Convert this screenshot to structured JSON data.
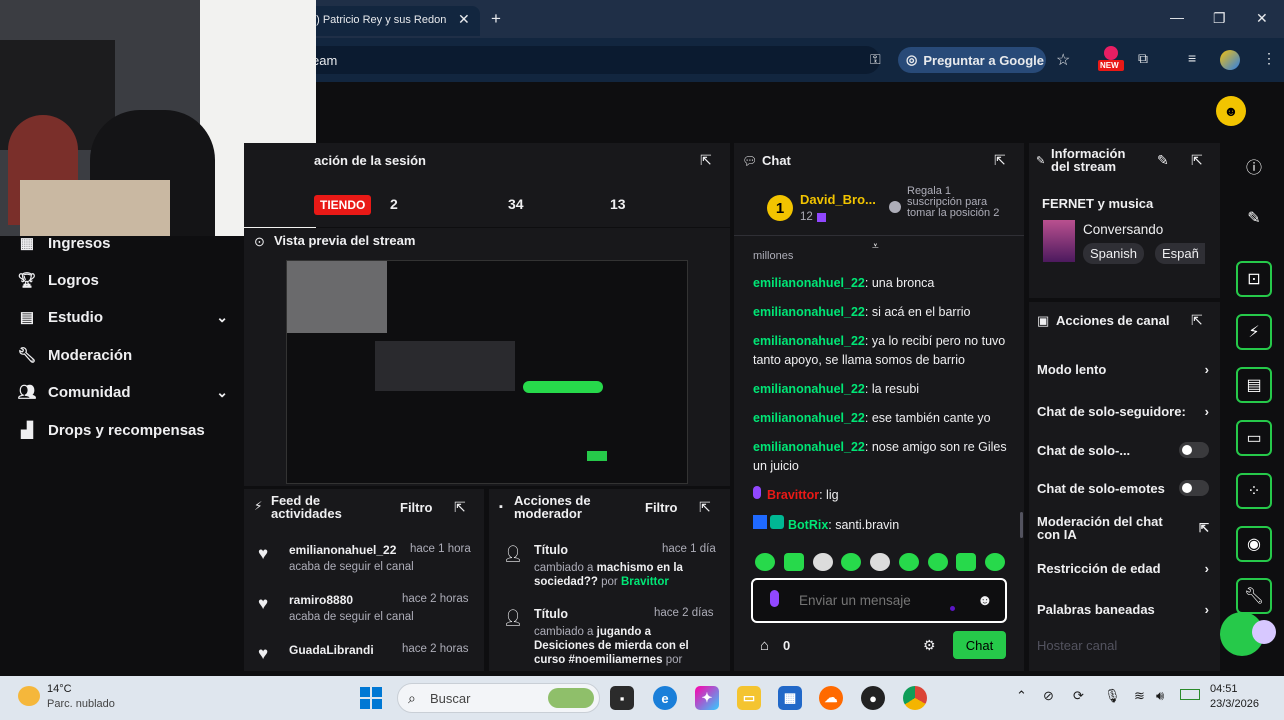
{
  "browser": {
    "tab_title": "8) Patricio Rey y sus Redon",
    "url_text": "eam",
    "google_button": "Preguntar a Google",
    "new_badge": "NEW"
  },
  "session_panel": {
    "title": "ación de la sesión",
    "live_badge": "TIENDO",
    "stats": [
      "2",
      "34",
      "13"
    ]
  },
  "preview": {
    "title": "Vista previa del stream"
  },
  "sidebar": {
    "items": [
      {
        "label": "Ingresos",
        "icon": "money-icon"
      },
      {
        "label": "Logros",
        "icon": "trophy-icon"
      },
      {
        "label": "Estudio",
        "icon": "studio-icon",
        "expandable": true
      },
      {
        "label": "Moderación",
        "icon": "wrench-icon"
      },
      {
        "label": "Comunidad",
        "icon": "people-icon",
        "expandable": true
      },
      {
        "label": "Drops y recompensas",
        "icon": "drops-icon"
      }
    ]
  },
  "chat": {
    "title": "Chat",
    "leader": {
      "rank": "1",
      "name": "David_Bro...",
      "count": "12",
      "prompt": "Regala 1 suscripción para tomar la posición 2"
    },
    "cut_top": "millones",
    "messages": [
      {
        "user": "emilianonahuel_22",
        "text": "una bronca"
      },
      {
        "user": "emilianonahuel_22",
        "text": "si acá en el barrio"
      },
      {
        "user": "emilianonahuel_22",
        "text": "ya lo recibí pero no tuvo tanto apoyo, se llama somos de barrio"
      },
      {
        "user": "emilianonahuel_22",
        "text": "la resubi"
      },
      {
        "user": "emilianonahuel_22",
        "text": "ese también cante yo"
      },
      {
        "user": "emilianonahuel_22",
        "text": "nose amigo son re Giles un juicio"
      },
      {
        "user": "Bravittor",
        "text": "lig"
      },
      {
        "user": "BotRix",
        "text": "santi.bravin"
      }
    ],
    "input_placeholder": "Enviar un mensaje",
    "points": "0",
    "send_label": "Chat"
  },
  "stream_info": {
    "title": "Información del stream",
    "stream_title": "FERNET y musica",
    "category": "Conversando",
    "tags": [
      "Spanish",
      "Españ"
    ]
  },
  "channel_actions": {
    "title": "Acciones de canal",
    "rows": [
      {
        "label": "Modo lento",
        "control": "chevron"
      },
      {
        "label": "Chat de solo-seguidore:",
        "control": "chevron"
      },
      {
        "label": "Chat de solo-...",
        "control": "toggle"
      },
      {
        "label": "Chat de solo-emotes",
        "control": "toggle"
      },
      {
        "label": "Moderación del chat con IA",
        "control": "external"
      },
      {
        "label": "Restricción de edad",
        "control": "chevron"
      },
      {
        "label": "Palabras baneadas",
        "control": "chevron"
      },
      {
        "label": "Hostear canal",
        "control": "none"
      }
    ]
  },
  "activity_feed": {
    "title": "Feed de actividades",
    "filter": "Filtro",
    "items": [
      {
        "user": "emilianonahuel_22",
        "time": "hace 1 hora",
        "action": "acaba de seguir el canal"
      },
      {
        "user": "ramiro8880",
        "time": "hace 2 horas",
        "action": "acaba de seguir el canal"
      },
      {
        "user": "GuadaLibrandi",
        "time": "hace 2 horas",
        "action": ""
      }
    ]
  },
  "mod_actions": {
    "title": "Acciones de moderador",
    "filter": "Filtro",
    "items": [
      {
        "field": "Título",
        "time": "hace 1 día",
        "prefix": "cambiado a",
        "value": "machismo en la sociedad??",
        "by": "por",
        "mod": "Bravittor"
      },
      {
        "field": "Título",
        "time": "hace 2 días",
        "prefix": "cambiado a",
        "value": "jugando a Desiciones de mierda con el curso #noemiliamernes",
        "by": "por",
        "mod": ""
      }
    ]
  },
  "taskbar": {
    "temp": "14°C",
    "weather": "Parc. nublado",
    "search": "Buscar",
    "time": "04:51",
    "date": "23/3/2026"
  },
  "colors": {
    "accent": "#00e676",
    "send": "#26c94a",
    "live": "#e91916",
    "panel": "#18181b"
  }
}
